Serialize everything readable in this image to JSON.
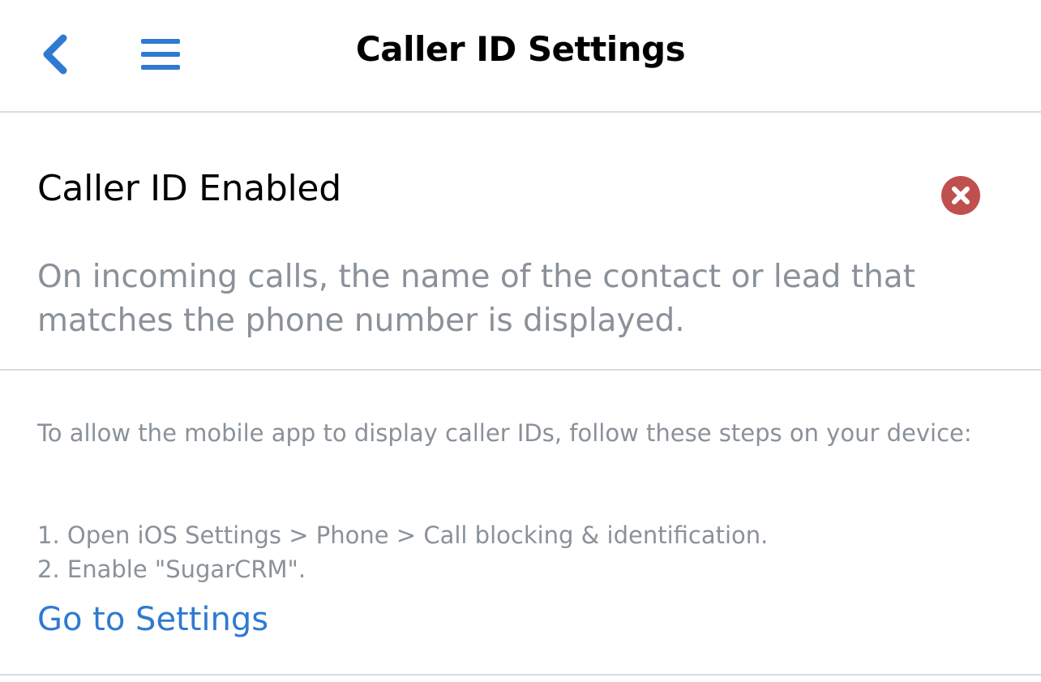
{
  "header": {
    "title": "Caller ID Settings",
    "back_icon": "chevron-left-icon",
    "menu_icon": "hamburger-menu-icon"
  },
  "setting": {
    "label": "Caller ID Enabled",
    "status_icon": "close-circle-icon",
    "description": "On incoming calls, the name of the contact or lead that matches the phone number is displayed."
  },
  "instructions": {
    "intro": "To allow the mobile app to display caller IDs, follow these steps on your device:",
    "steps": [
      "1. Open iOS Settings > Phone > Call blocking & identification.",
      "2. Enable \"SugarCRM\"."
    ],
    "link_label": "Go to Settings"
  },
  "colors": {
    "accent": "#2f7ad1",
    "error": "#c0504d",
    "secondary_text": "#8a9199",
    "divider": "#d9dde2"
  }
}
